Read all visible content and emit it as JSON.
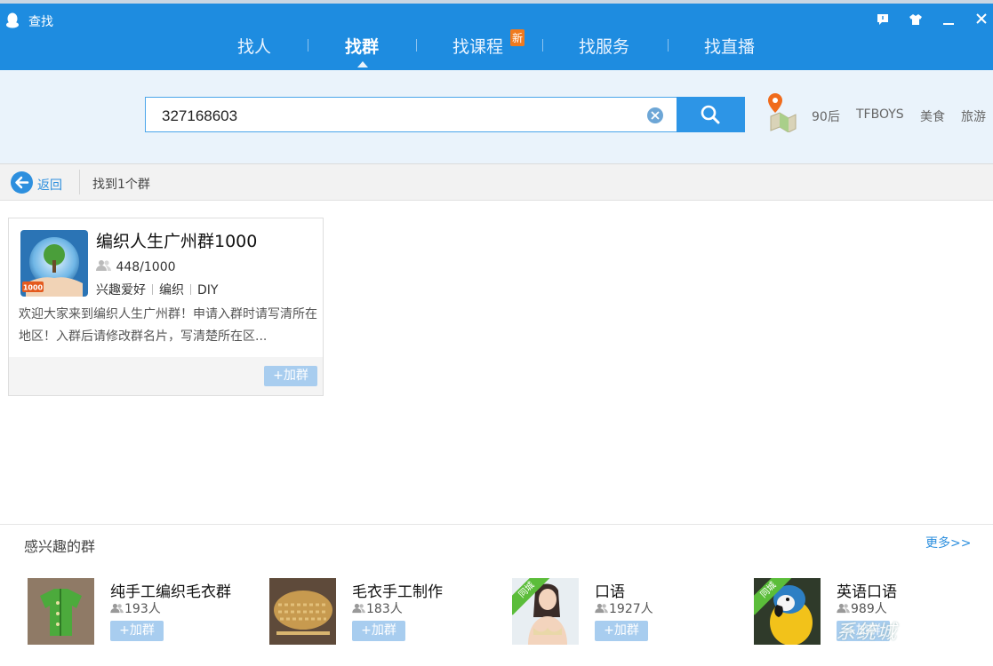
{
  "window": {
    "title": "查找"
  },
  "nav": {
    "tabs": [
      {
        "label": "找人"
      },
      {
        "label": "找群",
        "active": true
      },
      {
        "label": "找课程",
        "badge": "新"
      },
      {
        "label": "找服务"
      },
      {
        "label": "找直播"
      }
    ]
  },
  "search": {
    "value": "327168603",
    "hot_tags": [
      "90后",
      "TFBOYS",
      "美食",
      "旅游"
    ]
  },
  "results": {
    "back_label": "返回",
    "count_text": "找到1个群",
    "card": {
      "name": "编织人生广州群1000",
      "members": "448/1000",
      "avatar_badge": "1000",
      "tags": [
        "兴趣爱好",
        "编织",
        "DIY"
      ],
      "description": "欢迎大家来到编织人生广州群！申请入群时请写清所在地区！入群后请修改群名片，写清楚所在区...",
      "join_label": "+加群"
    }
  },
  "interest": {
    "title": "感兴趣的群",
    "more_label": "更多>>",
    "groups": [
      {
        "name": "纯手工编织毛衣群",
        "count": "193人",
        "join_label": "+加群"
      },
      {
        "name": "毛衣手工制作",
        "count": "183人",
        "join_label": "+加群"
      },
      {
        "name": "口语",
        "count": "1927人",
        "join_label": "+加群",
        "ribbon": "同城"
      },
      {
        "name": "英语口语",
        "count": "989人",
        "join_label": "+加群",
        "ribbon": "同城"
      }
    ]
  },
  "watermark": "系统城",
  "colors": {
    "header": "#1e8ce0",
    "accent": "#2d8fde",
    "search_zone": "#eaf3fb",
    "badge": "#f07a1e",
    "join_button": "#a8cdef"
  }
}
